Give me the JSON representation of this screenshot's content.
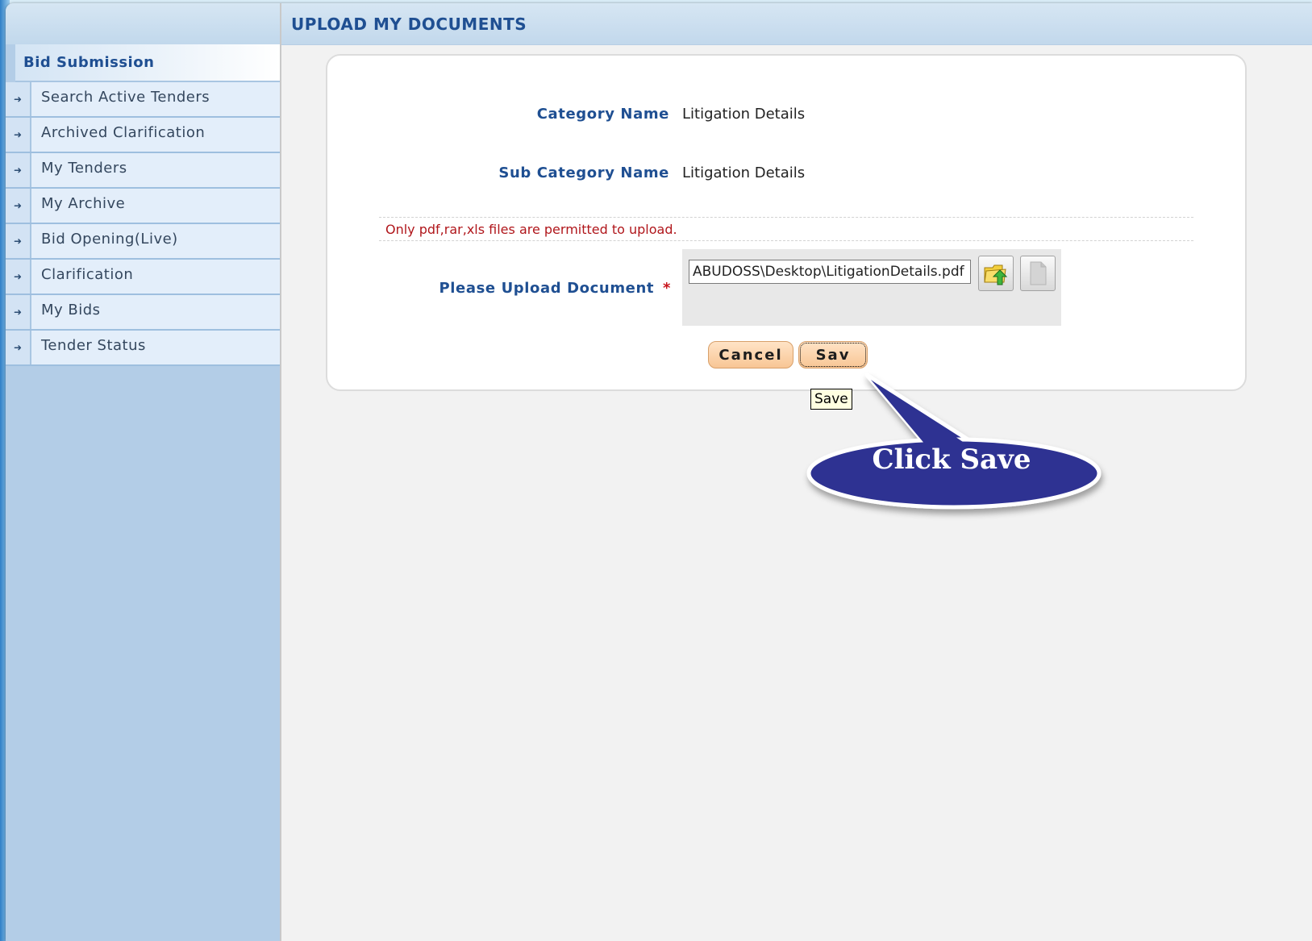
{
  "sidebar": {
    "header": "Bid Submission",
    "items": [
      {
        "label": "Search Active Tenders"
      },
      {
        "label": "Archived Clarification"
      },
      {
        "label": "My Tenders"
      },
      {
        "label": "My Archive"
      },
      {
        "label": "Bid Opening(Live)"
      },
      {
        "label": "Clarification"
      },
      {
        "label": "My Bids"
      },
      {
        "label": "Tender Status"
      }
    ]
  },
  "page": {
    "title": "UPLOAD MY DOCUMENTS"
  },
  "form": {
    "category_label": "Category Name",
    "category_value": "Litigation Details",
    "subcategory_label": "Sub Category Name",
    "subcategory_value": "Litigation Details",
    "note": "Only pdf,rar,xls files are permitted to upload.",
    "upload_label": "Please Upload Document",
    "required_mark": "*",
    "file_path": "ABUDOSS\\Desktop\\LitigationDetails.pdf",
    "cancel_label": "Cancel",
    "save_label": "Sav"
  },
  "tooltip": {
    "text": "Save"
  },
  "callout": {
    "text": "Click Save",
    "color": "#2d3192"
  },
  "colors": {
    "accent": "#1f4f92",
    "note": "#b0161b",
    "button": "#f8c695"
  }
}
